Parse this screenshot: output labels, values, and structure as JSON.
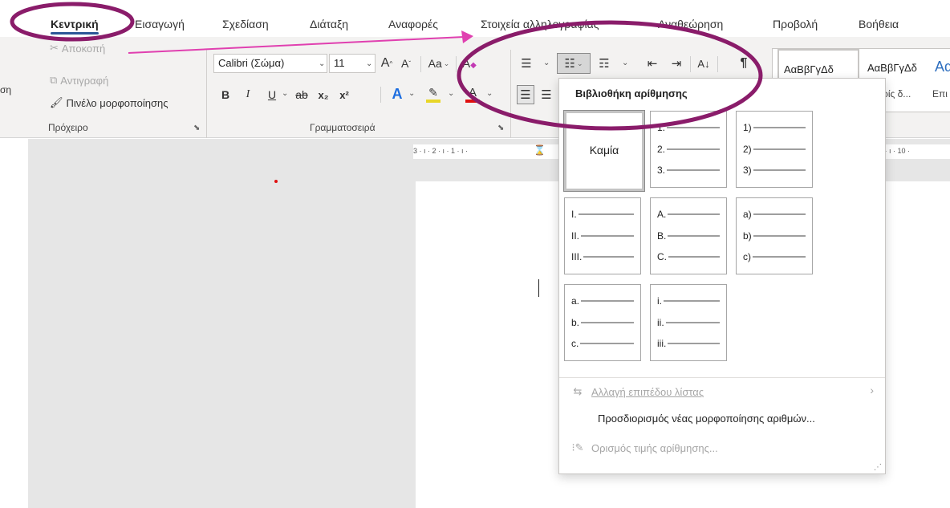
{
  "menu": {
    "tabs": [
      {
        "label": "Κεντρική",
        "active": true
      },
      {
        "label": "Εισαγωγή"
      },
      {
        "label": "Σχεδίαση"
      },
      {
        "label": "Διάταξη"
      },
      {
        "label": "Αναφορές"
      },
      {
        "label": "Στοιχεία αλληλογραφίας"
      },
      {
        "label": "Αναθεώρηση"
      },
      {
        "label": "Προβολή"
      },
      {
        "label": "Βοήθεια"
      }
    ]
  },
  "clipboard": {
    "label": "Πρόχειρο",
    "paste_partial": "ση",
    "cut": "Αποκοπή",
    "copy": "Αντιγραφή",
    "format_painter": "Πινέλο μορφοποίησης"
  },
  "font": {
    "label": "Γραμματοσειρά",
    "name": "Calibri (Σώμα)",
    "size": "11",
    "bold": "B",
    "italic": "I",
    "underline": "U",
    "strike": "ab",
    "subscript": "x₂",
    "superscript": "x²",
    "change_case": "Aa",
    "grow": "A",
    "shrink": "A"
  },
  "styles": {
    "items": [
      "ΑαΒβΓγΔδ",
      "ΑαΒβΓγΔδ",
      "Αα"
    ],
    "sub": [
      "ρίς δ...",
      "Επι"
    ]
  },
  "numbering_library": {
    "title": "Βιβλιοθήκη αρίθμησης",
    "none_label": "Καμία",
    "formats": [
      [
        "1.",
        "2.",
        "3."
      ],
      [
        "1)",
        "2)",
        "3)"
      ],
      [
        "I.",
        "II.",
        "III."
      ],
      [
        "A.",
        "B.",
        "C."
      ],
      [
        "a)",
        "b)",
        "c)"
      ],
      [
        "a.",
        "b.",
        "c."
      ],
      [
        "i.",
        "ii.",
        "iii."
      ]
    ],
    "commands": {
      "change_list_level": "Αλλαγή επιπέδου λίστας",
      "define_new_format": "Προσδιορισμός νέας μορφοποίησης αριθμών...",
      "set_numbering_value": "Ορισμός τιμής αρίθμησης..."
    }
  },
  "ruler": {
    "left_ticks": "3 · ı · 2 · ı · 1 · ı ·",
    "right_ticks": "9 · ı · 10 ·"
  },
  "colors": {
    "annotation_ellipse": "#8a1c6a",
    "annotation_arrow": "#e040b0",
    "text_highlight": "#e8d628",
    "font_color": "#e01010",
    "accent_blue": "#2b5797"
  }
}
